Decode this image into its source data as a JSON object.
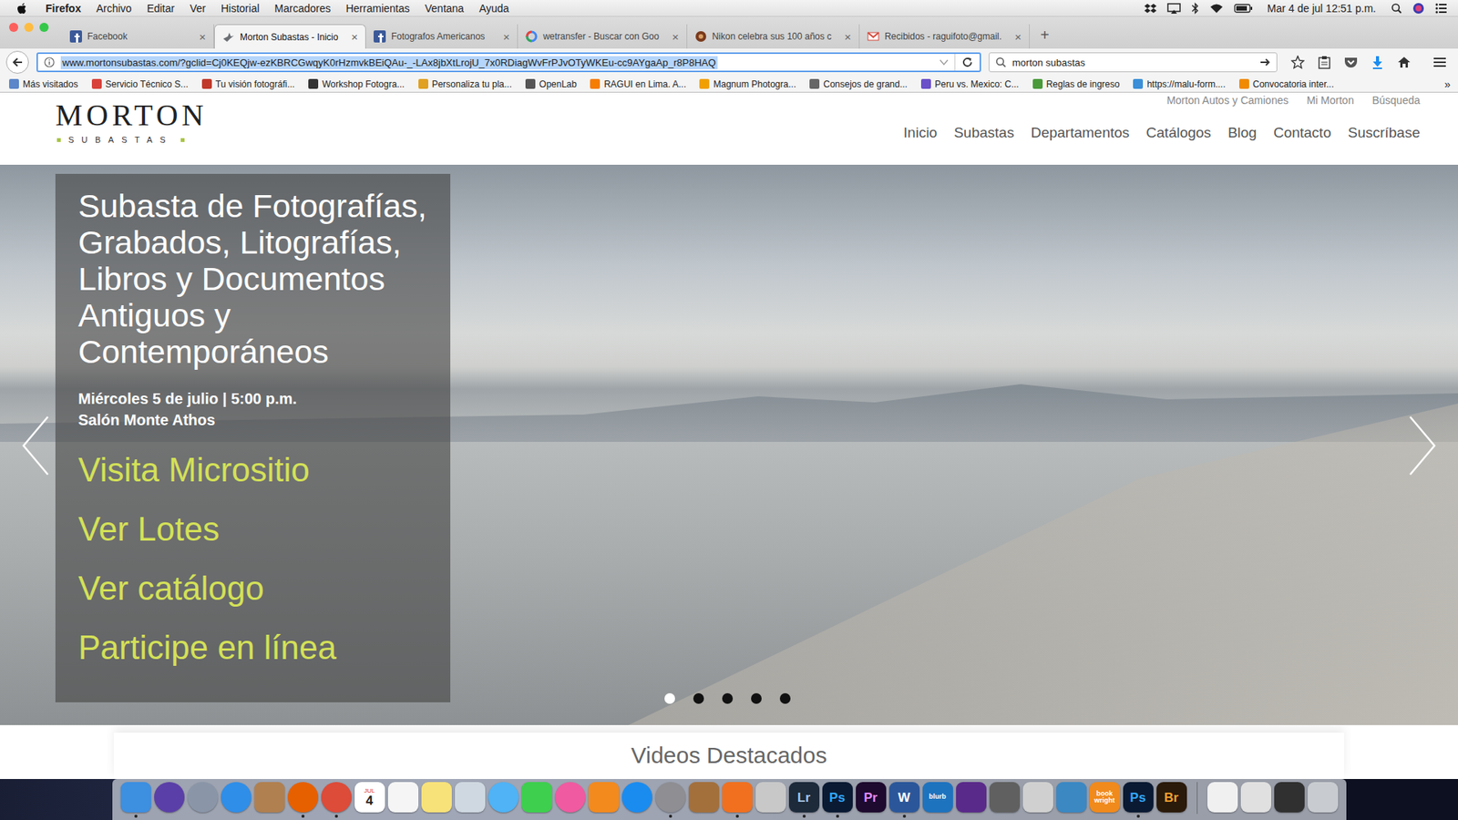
{
  "menubar": {
    "app": "Firefox",
    "items": [
      "Archivo",
      "Editar",
      "Ver",
      "Historial",
      "Marcadores",
      "Herramientas",
      "Ventana",
      "Ayuda"
    ],
    "clock": "Mar 4 de jul  12:51 p.m."
  },
  "tabs": [
    {
      "label": "Facebook",
      "selected": false,
      "kind": "facebook"
    },
    {
      "label": "Morton Subastas - Inicio",
      "selected": true,
      "kind": "morton"
    },
    {
      "label": "Fotografos Americanos",
      "selected": false,
      "kind": "facebook"
    },
    {
      "label": "wetransfer - Buscar con Goo",
      "selected": false,
      "kind": "google"
    },
    {
      "label": "Nikon celebra sus 100 años c",
      "selected": false,
      "kind": "nikon"
    },
    {
      "label": "Recibidos - raguifoto@gmail.",
      "selected": false,
      "kind": "gmail"
    }
  ],
  "tab_close": "×",
  "new_tab": "+",
  "navbar": {
    "url": "www.mortonsubastas.com/?gclid=Cj0KEQjw-ezKBRCGwqyK0rHzmvkBEiQAu-_-LAx8jbXtLrojU_7x0RDiagWvFrPJvOTyWKEu-cc9AYgaAp_r8P8HAQ",
    "url_selected": true,
    "search": "morton subastas"
  },
  "bookmarks": [
    {
      "label": "Más visitados",
      "color": "#5b86c9"
    },
    {
      "label": "Servicio Técnico S...",
      "color": "#d8413a"
    },
    {
      "label": "Tu visión fotográfi...",
      "color": "#c0392b"
    },
    {
      "label": "Workshop Fotogra...",
      "color": "#333333"
    },
    {
      "label": "Personaliza tu pla...",
      "color": "#e0a020"
    },
    {
      "label": "OpenLab",
      "color": "#555555"
    },
    {
      "label": "RAGUI en Lima. A...",
      "color": "#f57d00"
    },
    {
      "label": "Magnum Photogra...",
      "color": "#f0a000"
    },
    {
      "label": "Consejos de grand...",
      "color": "#666666"
    },
    {
      "label": "Peru vs. Mexico: C...",
      "color": "#6a4fc9"
    },
    {
      "label": "Reglas de ingreso",
      "color": "#4a9a3a"
    },
    {
      "label": "https://malu-form....",
      "color": "#3a8fd8"
    },
    {
      "label": "Convocatoria inter...",
      "color": "#f08a00"
    }
  ],
  "bookmarks_more": "»",
  "page": {
    "top_links": [
      "Morton Autos y Camiones",
      "Mi Morton",
      "Búsqueda"
    ],
    "logo": {
      "name": "MORTON",
      "sub": "SUBASTAS"
    },
    "nav": [
      "Inicio",
      "Subastas",
      "Departamentos",
      "Catálogos",
      "Blog",
      "Contacto",
      "Suscríbase"
    ],
    "hero": {
      "title": "Subasta de Fotografías, Grabados, Litografías, Libros y Documentos Antiguos y Contemporáneos",
      "date": "Miércoles 5 de julio | 5:00 p.m.",
      "venue": "Salón Monte Athos",
      "links": [
        "Visita Micrositio",
        "Ver Lotes",
        "Ver catálogo",
        "Participe en línea"
      ],
      "slides": [
        {
          "selected": true
        },
        {
          "selected": false
        },
        {
          "selected": false
        },
        {
          "selected": false
        },
        {
          "selected": false
        }
      ]
    },
    "section_title": "Videos Destacados"
  },
  "dock": {
    "apps": [
      {
        "label": "",
        "color": "#3d8fe0",
        "kind": "square",
        "running": true
      },
      {
        "label": "",
        "color": "#5b3fa8",
        "kind": "round",
        "running": false
      },
      {
        "label": "",
        "color": "#8a96a8",
        "kind": "round",
        "running": false
      },
      {
        "label": "",
        "color": "#2f8ee8",
        "kind": "round",
        "running": false
      },
      {
        "label": "",
        "color": "#b08050",
        "kind": "square",
        "running": false
      },
      {
        "label": "",
        "color": "#e66000",
        "kind": "round",
        "running": true
      },
      {
        "label": "",
        "color": "#dd4b39",
        "kind": "round",
        "running": true
      },
      {
        "label": "4",
        "sub": "JUL",
        "color": "#ffffff",
        "text_color": "#222222",
        "kind": "square",
        "running": false
      },
      {
        "label": "",
        "color": "#f5f5f5",
        "kind": "square",
        "running": false
      },
      {
        "label": "",
        "color": "#f7e27a",
        "kind": "square",
        "running": false
      },
      {
        "label": "",
        "color": "#cfd8e0",
        "kind": "square",
        "running": false
      },
      {
        "label": "",
        "color": "#4fb3f6",
        "kind": "round",
        "running": false
      },
      {
        "label": "",
        "color": "#3ecf4e",
        "kind": "square",
        "running": false
      },
      {
        "label": "",
        "color": "#f05aa0",
        "kind": "round",
        "running": false
      },
      {
        "label": "",
        "color": "#f28a1e",
        "kind": "square",
        "running": false
      },
      {
        "label": "",
        "color": "#1a8cf0",
        "kind": "round",
        "running": false
      },
      {
        "label": "",
        "color": "#8e8e93",
        "kind": "round",
        "running": true
      },
      {
        "label": "",
        "color": "#a3703c",
        "kind": "square",
        "running": false
      },
      {
        "label": "",
        "color": "#f07020",
        "kind": "square",
        "running": true
      },
      {
        "label": "",
        "color": "#c8c8c8",
        "kind": "square",
        "running": false
      },
      {
        "label": "Lr",
        "color": "#1c2a3a",
        "text_color": "#a9c7e8",
        "kind": "square",
        "running": true
      },
      {
        "label": "Ps",
        "color": "#0b1a33",
        "text_color": "#31a8ff",
        "kind": "square",
        "running": true
      },
      {
        "label": "Pr",
        "color": "#1e0a2e",
        "text_color": "#e08aff",
        "kind": "square",
        "running": false
      },
      {
        "label": "W",
        "color": "#2b579a",
        "text_color": "#ffffff",
        "kind": "square",
        "running": true
      },
      {
        "label": "blurb",
        "color": "#1e73be",
        "text_color": "#ffffff",
        "kind": "square",
        "running": false
      },
      {
        "label": "",
        "color": "#5a2a8a",
        "kind": "square",
        "running": false
      },
      {
        "label": "",
        "color": "#606060",
        "kind": "square",
        "running": false
      },
      {
        "label": "",
        "color": "#d0d0d0",
        "kind": "square",
        "running": false
      },
      {
        "label": "",
        "color": "#3b88c3",
        "kind": "square",
        "running": false
      },
      {
        "label": "book wright",
        "color": "#f08a1c",
        "text_color": "#ffffff",
        "kind": "square",
        "running": false
      },
      {
        "label": "Ps",
        "color": "#0b1a33",
        "text_color": "#31a8ff",
        "kind": "square",
        "running": true
      },
      {
        "label": "Br",
        "color": "#2a1a0a",
        "text_color": "#f0a030",
        "kind": "square",
        "running": false
      }
    ],
    "stacks": [
      {
        "color": "#f0f0f0"
      },
      {
        "color": "#e0e0e0"
      },
      {
        "color": "#303030"
      },
      {
        "color": "#c8ccd0"
      }
    ]
  }
}
